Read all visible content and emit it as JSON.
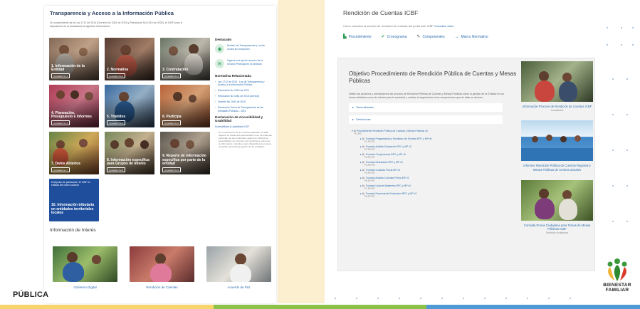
{
  "footer": {
    "label": "PÚBLICA"
  },
  "logo": {
    "line1": "BIENESTAR",
    "line2": "FAMILIAR"
  },
  "left": {
    "title": "Transparencia y Acceso a la Información Pública",
    "intro": "En cumplimiento de la Ley 1712 de 2014 (Decreto No 1081 de 2015 y Resolución No 1519 de 2020), el ICBF pone a disposición de la ciudadanía la siguiente información:",
    "tiles": [
      {
        "label": "1. Información de la Entidad",
        "button": "Consultar No 1"
      },
      {
        "label": "2. Normativa",
        "button": "Consultar No 2"
      },
      {
        "label": "3. Contratación",
        "button": "Consultar No 3"
      },
      {
        "label": "4. Planeación, Presupuesto e Informes",
        "button": "Consultar No 4"
      },
      {
        "label": "5. Trámites",
        "button": "Consultar No 5"
      },
      {
        "label": "6. Participa",
        "button": "Consultar No 6"
      },
      {
        "label": "7. Datos Abiertos",
        "button": "Consultar No 7"
      },
      {
        "label": "8. Información específica para Grupos de Interés",
        "button": "Consultar No 8"
      },
      {
        "label": "9. Reporte de información específica por parte de la entidad",
        "button": "Consultar No 9"
      }
    ],
    "tile10": {
      "note": "Excepción de publicación: El ICBF es entidad del orden nacional",
      "label": "10. Información tributaria en entidades territoriales locales"
    },
    "sidebar": {
      "destacado_title": "Destacado",
      "destacado": [
        {
          "text": "Modelo de Transparencia y Lucha contra la Corrupción"
        },
        {
          "text": "Ingrese a la opción acceso de la sección Participa en la decisión"
        }
      ],
      "normativa_title": "Normativa Relacionada",
      "normativa": [
        "Ley 1712 de 2014 - Ley de Transparencia y Acceso a la Información Pública",
        "Resolución No 1519 de 2020",
        "Resolución No 1081 de 2015 (Anexos)",
        "Decreto No 1081 de 2015",
        "Resolución Tercio de Transparencia de las Entidades Públicas - 2021"
      ],
      "declaracion_title": "Declaración de Accesibilidad y Usabilidad",
      "accesibilidad_link": "Accesibilidad y Usabilidad ICBF",
      "accesibilidad_text": "En cumplimiento de la normativa aplicable, el ICBF dispone su Portal web para facilitar el uso de todas las personas, de sus contenidos según los criterios de accesibilidad, sin importar sus condiciones, para que la información y trámites estén disponibles de manera accesible para toda la gestión de las entidades."
    },
    "interes_title": "Información de Interés",
    "interes": [
      {
        "label": "Gobierno Digital"
      },
      {
        "label": "Rendición de Cuentas"
      },
      {
        "label": "Acuerdo de Paz"
      }
    ]
  },
  "right": {
    "title": "Rendición de Cuentas ICBF",
    "subtitle": "Cómo consultar la sección de rendición de cuentas del portal web ICBF",
    "subtitle_link": "Consultar video",
    "tabs": [
      {
        "label": "Procedimiento",
        "icon": "document-icon"
      },
      {
        "label": "Cronograma",
        "icon": "check-icon"
      },
      {
        "label": "Componentes",
        "icon": "pencil-icon"
      },
      {
        "label": "Marco Normativo",
        "icon": "arrow-icon"
      }
    ],
    "objective_title": "Objetivo Procedimiento de Rendición Pública de Cuentas y Mesas Públicas",
    "objective_desc": "Definir las acciones y orientaciones del proceso de Rendición Pública de Cuentas y Mesas Públicas sobre la gestión de la Entidad en los temas definidos como de interés para la sociedad y realizar el seguimiento a los compromisos que de ellas se deriven.",
    "accordions": [
      "Generalidades",
      "Definiciones"
    ],
    "procedure": {
      "root": "Procedimiento Rendición Pública de Cuentas y Mesas Públicas v5",
      "root_code": "P2.PE",
      "items": [
        {
          "label": "Formato Programación y Monitoreo de Eventos RPC y MP v6",
          "code": "F1.P2.PE"
        },
        {
          "label": "Formato Análisis Evaluación RPC y MP v3",
          "code": "F2.P2.PE"
        },
        {
          "label": "Formato Compromisos RPC y MP v3",
          "code": "F3.P2.PE"
        },
        {
          "label": "Formato Resultados RPC y MP v3",
          "code": "F4.P2.PE"
        },
        {
          "label": "Formato Consulta Previa MP v3",
          "code": "F5.P2.PE"
        },
        {
          "label": "Formato Análisis Consulta Previa MP v3",
          "code": "F6.P2.PE"
        },
        {
          "label": "Formato Lista de Asistentes RPC y MP v3",
          "code": "F7.P2.PE"
        },
        {
          "label": "Formato Encuesta de Evaluación RPC y MP v3",
          "code": "F8.P2.PE"
        }
      ]
    },
    "side_cards": [
      {
        "title": "Información Proceso de Rendición de Cuentas ICBF",
        "meta": "Consultados"
      },
      {
        "title": "Informes Rendición Pública de Cuentas Regional y Mesas Públicas de Centros Zonales",
        "meta": ""
      },
      {
        "title": "Consulta Previa Ciudadana para Temas de Mesas Públicas ICBF",
        "meta": "Definición ciudadanos"
      }
    ]
  },
  "colors": {
    "accent_blue": "#2a6cb0",
    "accent_green": "#2d9c5a",
    "tile10_blue": "#1f4f9c",
    "band_yellow": "#fcefd0"
  }
}
